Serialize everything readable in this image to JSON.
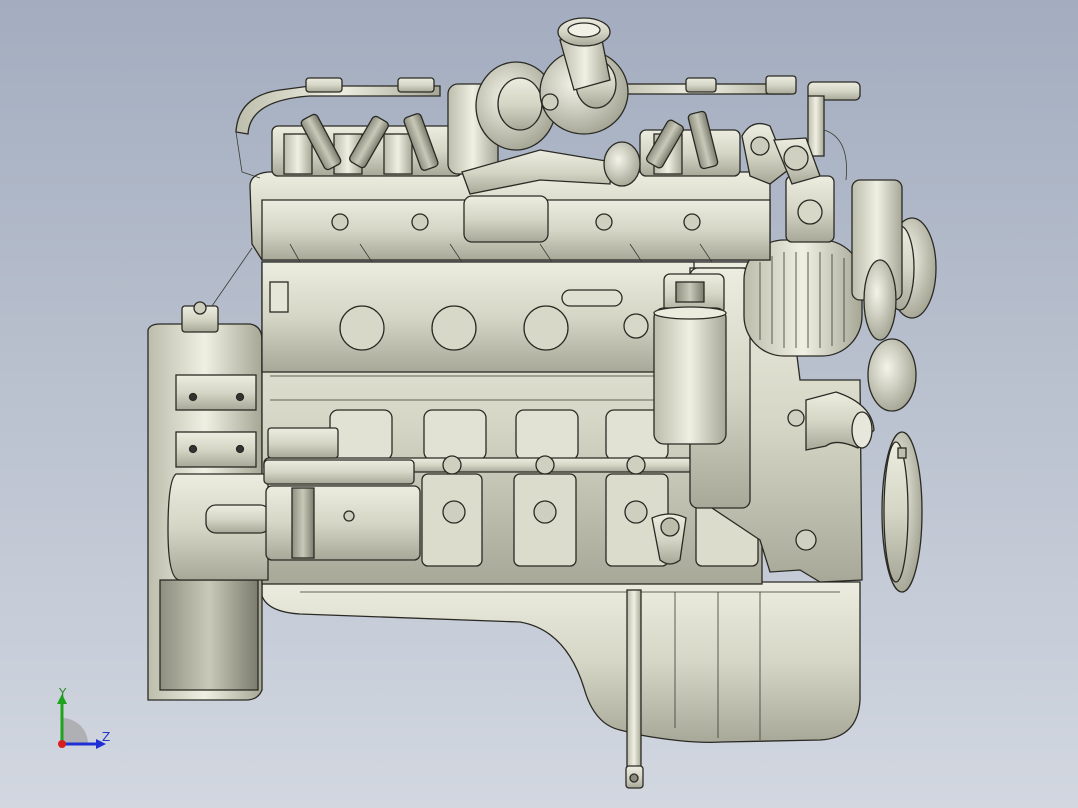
{
  "view": {
    "background_top": "#a3adbf",
    "background_bottom": "#d2d7e0",
    "model_fill": "#d9d9c9",
    "model_edge": "#2a2a24"
  },
  "triad": {
    "y_label": "Y",
    "z_label": "Z",
    "y_color": "#1fa31f",
    "z_color": "#1f2fd6",
    "x_color": "#d61f1f"
  }
}
